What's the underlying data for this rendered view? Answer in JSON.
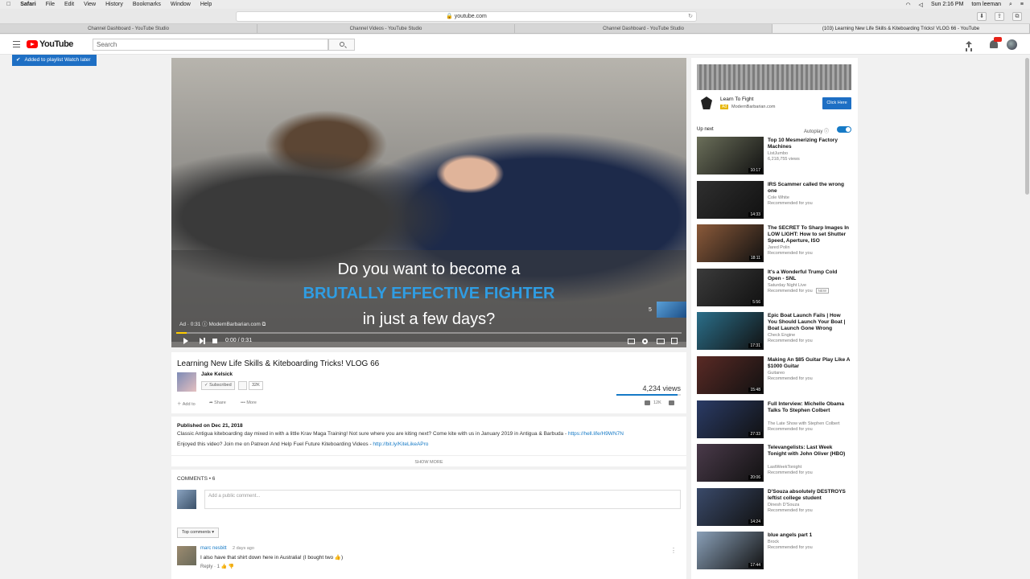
{
  "menubar": {
    "app": "Safari",
    "items": [
      "File",
      "Edit",
      "View",
      "History",
      "Bookmarks",
      "Window",
      "Help"
    ],
    "clock": "Sun 2:16 PM",
    "user": "tom leeman"
  },
  "browser": {
    "url": "youtube.com",
    "tabs": [
      "Channel Dashboard - YouTube Studio",
      "Channel Videos - YouTube Studio",
      "Channel Dashboard - YouTube Studio",
      "(103) Learning New Life Skills & Kiteboarding Tricks! VLOG 66 - YouTube"
    ]
  },
  "header": {
    "logo_text": "YouTube",
    "search_placeholder": "Search"
  },
  "toast": {
    "text": "Added to playlist Watch later"
  },
  "player": {
    "ad_line1": "Do you want to become a",
    "ad_line2": "BRUTALLY EFFECTIVE FIGHTER",
    "ad_line3": "in just a few days?",
    "ad_meta": "Ad · 0:31  ⓘ  ModernBarbarian.com ⧉",
    "ad_count": "5",
    "time": "0:00 / 0:31",
    "progress": 0.02
  },
  "video": {
    "title": "Learning New Life Skills & Kiteboarding Tricks! VLOG 66",
    "channel": "Jake Kelsick",
    "subscribed_label": "Subscribed",
    "sub_count": "32K",
    "views": "4,234 views",
    "like_ratio": 0.95,
    "add_to": "Add to",
    "share": "Share",
    "more": "More",
    "likes": "12K"
  },
  "description": {
    "published": "Published on Dec 21, 2018",
    "line1": "Classic Antigua kiteboarding day mixed in with a little Krav Maga Training! Not sure where you are kiting next? Come kite with us in January 2019 in Antigua & Barbuda - ",
    "link1": "https://hell.life/H9WN7N",
    "line2": "Enjoyed this video? Join me on Patreon And Help Fuel Future Kiteboarding Videos - ",
    "link2": "http://bit.ly/KiteLikeAPro",
    "show_more": "SHOW MORE"
  },
  "comments": {
    "header": "COMMENTS • 6",
    "input_placeholder": "Add a public comment...",
    "sort": "Top comments ▾",
    "items": [
      {
        "author": "marc nesbitt",
        "date": "2 days ago",
        "text": "I also have that shirt down here in Australia! (I bought two 👍)",
        "reply": "Reply · 1"
      }
    ]
  },
  "sidebar": {
    "ad": {
      "title": "Learn To Fight",
      "badge": "Ad",
      "url": "ModernBarbarian.com",
      "cta": "Click Here"
    },
    "up_next": "Up next",
    "autoplay": "Autoplay  ⓘ",
    "recs": [
      {
        "title": "Top 10 Mesmerizing Factory Machines",
        "channel": "ListJumbo",
        "meta": "6,218,755 views",
        "duration": "10:17",
        "color": "#6b6f5a"
      },
      {
        "title": "IRS Scammer called the wrong one",
        "channel": "Cole White",
        "meta": "Recommended for you",
        "duration": "14:33",
        "color": "#2f2f2f"
      },
      {
        "title": "The SECRET To Sharp Images In LOW LIGHT: How to set Shutter Speed, Aperture, ISO",
        "channel": "Jared Polin",
        "meta": "Recommended for you",
        "duration": "18:11",
        "color": "#8b5a3a"
      },
      {
        "title": "It's a Wonderful Trump Cold Open - SNL",
        "channel": "Saturday Night Live",
        "meta": "Recommended for you",
        "new": "NEW",
        "duration": "5:56",
        "color": "#3b3b3b"
      },
      {
        "title": "Epic Boat Launch Fails | How You Should Launch Your Boat | Boat Launch Gone Wrong",
        "channel": "Check Engine",
        "meta": "Recommended for you",
        "duration": "17:31",
        "color": "#2b6f8a"
      },
      {
        "title": "Making An $85 Guitar Play Like A $1000 Guitar",
        "channel": "Guitareo",
        "meta": "Recommended for you",
        "duration": "15:48",
        "color": "#5a2a25"
      },
      {
        "title": "Full Interview: Michelle Obama Talks To Stephen Colbert",
        "channel": "The Late Show with Stephen Colbert",
        "meta": "Recommended for you",
        "duration": "27:33",
        "color": "#2a3b66"
      },
      {
        "title": "Televangelists: Last Week Tonight with John Oliver (HBO)",
        "channel": "LastWeekTonight",
        "meta": "Recommended for you",
        "duration": "20:06",
        "color": "#4a3a4a"
      },
      {
        "title": "D'Souza absolutely DESTROYS leftist college student",
        "channel": "Dinesh D'Souza",
        "meta": "Recommended for you",
        "duration": "14:24",
        "color": "#3a4a6a"
      },
      {
        "title": "blue angels part 1",
        "channel": "Brock",
        "meta": "Recommended for you",
        "duration": "17:44",
        "color": "#8aa0b8"
      }
    ]
  }
}
